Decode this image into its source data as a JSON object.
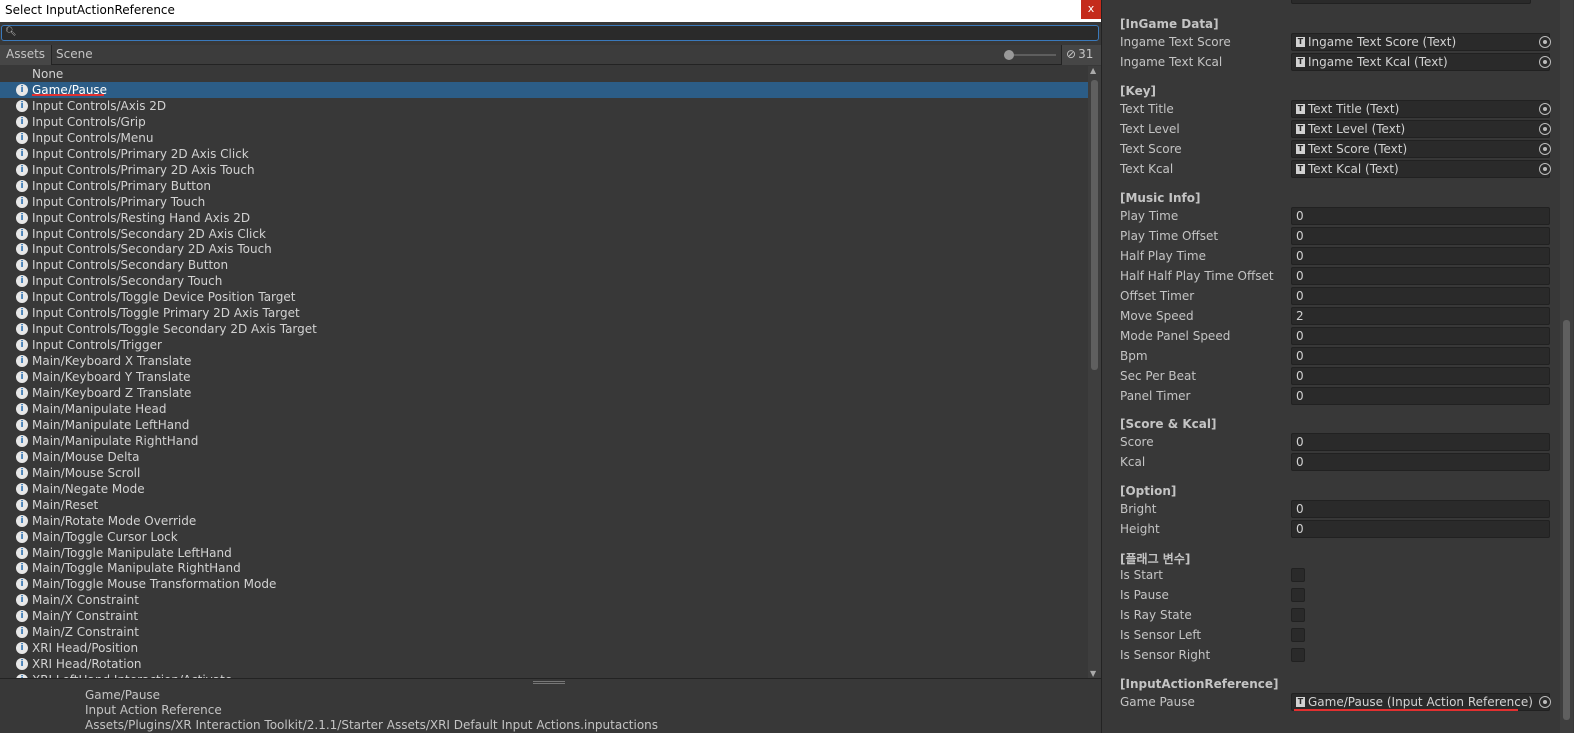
{
  "dialog": {
    "title": "Select InputActionReference",
    "close_label": "x",
    "search": {
      "icon": "search-icon",
      "value": "",
      "placeholder": ""
    },
    "tabs": [
      {
        "label": "Assets"
      },
      {
        "label": "Scene"
      }
    ],
    "hidden_count": "31",
    "items": [
      {
        "label": "None",
        "icon": false
      },
      {
        "label": "Game/Pause",
        "icon": true,
        "selected": true
      },
      {
        "label": "Input Controls/Axis 2D",
        "icon": true
      },
      {
        "label": "Input Controls/Grip",
        "icon": true
      },
      {
        "label": "Input Controls/Menu",
        "icon": true
      },
      {
        "label": "Input Controls/Primary 2D Axis Click",
        "icon": true
      },
      {
        "label": "Input Controls/Primary 2D Axis Touch",
        "icon": true
      },
      {
        "label": "Input Controls/Primary Button",
        "icon": true
      },
      {
        "label": "Input Controls/Primary Touch",
        "icon": true
      },
      {
        "label": "Input Controls/Resting Hand Axis 2D",
        "icon": true
      },
      {
        "label": "Input Controls/Secondary 2D Axis Click",
        "icon": true
      },
      {
        "label": "Input Controls/Secondary 2D Axis Touch",
        "icon": true
      },
      {
        "label": "Input Controls/Secondary Button",
        "icon": true
      },
      {
        "label": "Input Controls/Secondary Touch",
        "icon": true
      },
      {
        "label": "Input Controls/Toggle Device Position Target",
        "icon": true
      },
      {
        "label": "Input Controls/Toggle Primary 2D Axis Target",
        "icon": true
      },
      {
        "label": "Input Controls/Toggle Secondary 2D Axis Target",
        "icon": true
      },
      {
        "label": "Input Controls/Trigger",
        "icon": true
      },
      {
        "label": "Main/Keyboard X Translate",
        "icon": true
      },
      {
        "label": "Main/Keyboard Y Translate",
        "icon": true
      },
      {
        "label": "Main/Keyboard Z Translate",
        "icon": true
      },
      {
        "label": "Main/Manipulate Head",
        "icon": true
      },
      {
        "label": "Main/Manipulate LeftHand",
        "icon": true
      },
      {
        "label": "Main/Manipulate RightHand",
        "icon": true
      },
      {
        "label": "Main/Mouse Delta",
        "icon": true
      },
      {
        "label": "Main/Mouse Scroll",
        "icon": true
      },
      {
        "label": "Main/Negate Mode",
        "icon": true
      },
      {
        "label": "Main/Reset",
        "icon": true
      },
      {
        "label": "Main/Rotate Mode Override",
        "icon": true
      },
      {
        "label": "Main/Toggle Cursor Lock",
        "icon": true
      },
      {
        "label": "Main/Toggle Manipulate LeftHand",
        "icon": true
      },
      {
        "label": "Main/Toggle Manipulate RightHand",
        "icon": true
      },
      {
        "label": "Main/Toggle Mouse Transformation Mode",
        "icon": true
      },
      {
        "label": "Main/X Constraint",
        "icon": true
      },
      {
        "label": "Main/Y Constraint",
        "icon": true
      },
      {
        "label": "Main/Z Constraint",
        "icon": true
      },
      {
        "label": "XRI Head/Position",
        "icon": true
      },
      {
        "label": "XRI Head/Rotation",
        "icon": true
      },
      {
        "label": "XRI LeftHand Interaction/Activate",
        "icon": true
      }
    ],
    "details": {
      "name": "Game/Pause",
      "type": "Input Action Reference",
      "path": "Assets/Plugins/XR Interaction Toolkit/2.1.1/Starter Assets/XRI Default Input Actions.inputactions"
    }
  },
  "inspector": {
    "sections": [
      {
        "header": "[InGame Data]",
        "fields": [
          {
            "label": "Ingame Text Score",
            "kind": "object",
            "value": "Ingame Text Score (Text)"
          },
          {
            "label": "Ingame Text Kcal",
            "kind": "object",
            "value": "Ingame Text Kcal (Text)"
          }
        ]
      },
      {
        "header": "[Key]",
        "fields": [
          {
            "label": "Text Title",
            "kind": "object",
            "value": "Text Title (Text)"
          },
          {
            "label": "Text Level",
            "kind": "object",
            "value": "Text Level (Text)"
          },
          {
            "label": "Text Score",
            "kind": "object",
            "value": "Text Score  (Text)"
          },
          {
            "label": "Text Kcal",
            "kind": "object",
            "value": "Text Kcal (Text)"
          }
        ]
      },
      {
        "header": "[Music Info]",
        "fields": [
          {
            "label": "Play Time",
            "kind": "number",
            "value": "0"
          },
          {
            "label": "Play Time Offset",
            "kind": "number",
            "value": "0"
          },
          {
            "label": "Half Play Time",
            "kind": "number",
            "value": "0"
          },
          {
            "label": "Half Half Play Time Offset",
            "kind": "number",
            "value": "0"
          },
          {
            "label": "Offset Timer",
            "kind": "number",
            "value": "0"
          },
          {
            "label": "Move Speed",
            "kind": "number",
            "value": "2"
          },
          {
            "label": "Mode Panel Speed",
            "kind": "number",
            "value": "0"
          },
          {
            "label": "Bpm",
            "kind": "number",
            "value": "0"
          },
          {
            "label": "Sec Per Beat",
            "kind": "number",
            "value": "0"
          },
          {
            "label": "Panel Timer",
            "kind": "number",
            "value": "0"
          }
        ]
      },
      {
        "header": "[Score & Kcal]",
        "fields": [
          {
            "label": "Score",
            "kind": "number",
            "value": "0"
          },
          {
            "label": "Kcal",
            "kind": "number",
            "value": "0"
          }
        ]
      },
      {
        "header": "[Option]",
        "fields": [
          {
            "label": "Bright",
            "kind": "number",
            "value": "0"
          },
          {
            "label": "Height",
            "kind": "number",
            "value": "0"
          }
        ]
      },
      {
        "header": "[플래그 변수]",
        "fields": [
          {
            "label": "Is Start",
            "kind": "checkbox",
            "checked": false
          },
          {
            "label": "Is Pause",
            "kind": "checkbox",
            "checked": false
          },
          {
            "label": "Is Ray State",
            "kind": "checkbox",
            "checked": false
          },
          {
            "label": "Is Sensor Left",
            "kind": "checkbox",
            "checked": false
          },
          {
            "label": "Is Sensor Right",
            "kind": "checkbox",
            "checked": false
          }
        ]
      },
      {
        "header": "[InputActionReference]",
        "fields": [
          {
            "label": "Game Pause",
            "kind": "object",
            "value": "Game/Pause (Input Action Reference)"
          }
        ]
      }
    ]
  }
}
